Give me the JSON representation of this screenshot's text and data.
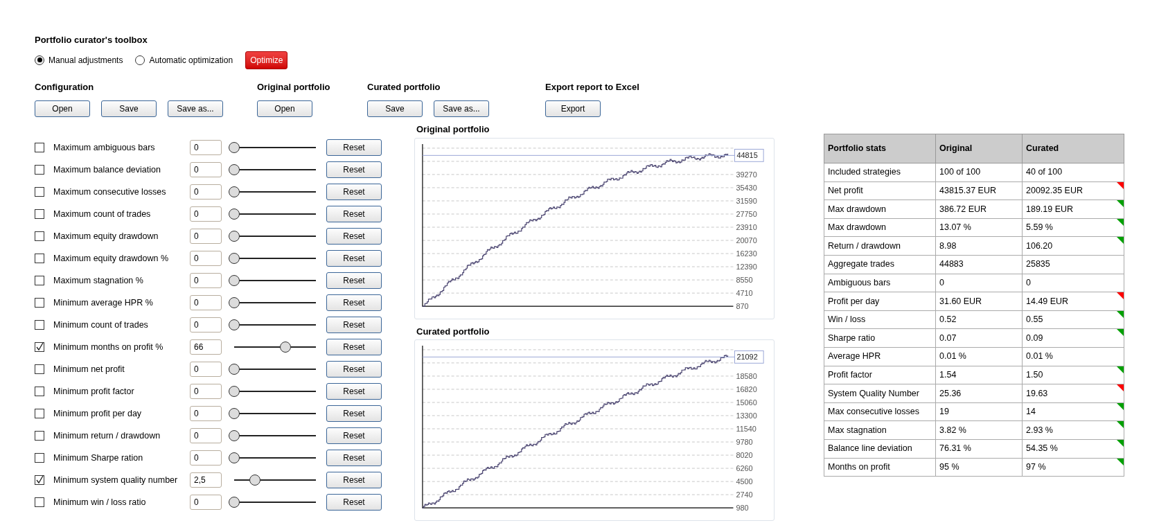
{
  "title": "Portfolio curator's toolbox",
  "modes": [
    {
      "label": "Manual adjustments",
      "selected": true
    },
    {
      "label": "Automatic optimization",
      "selected": false
    }
  ],
  "optimize_button": "Optimize",
  "file_groups": [
    {
      "heading": "Configuration",
      "buttons": [
        "Open",
        "Save",
        "Save as..."
      ]
    },
    {
      "heading": "Original portfolio",
      "buttons": [
        "Open"
      ]
    },
    {
      "heading": "Curated portfolio",
      "buttons": [
        "Save",
        "Save as..."
      ]
    },
    {
      "heading": "Export report to Excel",
      "buttons": [
        "Export"
      ]
    }
  ],
  "filters": [
    {
      "label": "Maximum ambiguous bars",
      "checked": false,
      "value": "0",
      "level": 0,
      "reset": "Reset"
    },
    {
      "label": "Maximum balance deviation",
      "checked": false,
      "value": "0",
      "level": 0,
      "reset": "Reset"
    },
    {
      "label": "Maximum consecutive losses",
      "checked": false,
      "value": "0",
      "level": 0,
      "reset": "Reset"
    },
    {
      "label": "Maximum count of trades",
      "checked": false,
      "value": "0",
      "level": 0,
      "reset": "Reset"
    },
    {
      "label": "Maximum equity drawdown",
      "checked": false,
      "value": "0",
      "level": 0,
      "reset": "Reset"
    },
    {
      "label": "Maximum equity drawdown %",
      "checked": false,
      "value": "0",
      "level": 0,
      "reset": "Reset"
    },
    {
      "label": "Maximum stagnation %",
      "checked": false,
      "value": "0",
      "level": 0,
      "reset": "Reset"
    },
    {
      "label": "Minimum average HPR %",
      "checked": false,
      "value": "0",
      "level": 0,
      "reset": "Reset"
    },
    {
      "label": "Minimum count of trades",
      "checked": false,
      "value": "0",
      "level": 0,
      "reset": "Reset"
    },
    {
      "label": "Minimum months on profit %",
      "checked": true,
      "value": "66",
      "level": 0.63,
      "reset": "Reset"
    },
    {
      "label": "Minimum net profit",
      "checked": false,
      "value": "0",
      "level": 0,
      "reset": "Reset"
    },
    {
      "label": "Minimum profit factor",
      "checked": false,
      "value": "0",
      "level": 0,
      "reset": "Reset"
    },
    {
      "label": "Minimum profit per day",
      "checked": false,
      "value": "0",
      "level": 0,
      "reset": "Reset"
    },
    {
      "label": "Minimum return / drawdown",
      "checked": false,
      "value": "0",
      "level": 0,
      "reset": "Reset"
    },
    {
      "label": "Minimum Sharpe ration",
      "checked": false,
      "value": "0",
      "level": 0,
      "reset": "Reset"
    },
    {
      "label": "Minimum system quality number",
      "checked": true,
      "value": "2,5",
      "level": 0.25,
      "reset": "Reset"
    },
    {
      "label": "Minimum win / loss ratio",
      "checked": false,
      "value": "0",
      "level": 0,
      "reset": "Reset"
    }
  ],
  "charts": [
    {
      "title": "Original portfolio",
      "current_value": "44815",
      "y_labels": [
        "39270",
        "35430",
        "31590",
        "27750",
        "23910",
        "20070",
        "16230",
        "12390",
        "8550",
        "4710",
        "870"
      ]
    },
    {
      "title": "Curated portfolio",
      "current_value": "21092",
      "y_labels": [
        "18580",
        "16820",
        "15060",
        "13300",
        "11540",
        "9780",
        "8020",
        "6260",
        "4500",
        "2740",
        "980"
      ]
    }
  ],
  "stats": {
    "columns": [
      "Portfolio stats",
      "Original",
      "Curated"
    ],
    "rows": [
      {
        "name": "Included strategies",
        "original": "100 of 100",
        "curated": "40 of 100"
      },
      {
        "name": "Net profit",
        "original": "43815.37 EUR",
        "curated": "20092.35 EUR",
        "color": "#ff0000"
      },
      {
        "name": "Max drawdown",
        "original": "386.72 EUR",
        "curated": "189.19 EUR",
        "color": "#00a000"
      },
      {
        "name": "Max drawdown",
        "original": "13.07 %",
        "curated": "5.59 %",
        "color": "#00a000"
      },
      {
        "name": "Return / drawdown",
        "original": "8.98",
        "curated": "106.20",
        "color": "#00a000"
      },
      {
        "name": "Aggregate trades",
        "original": "44883",
        "curated": "25835"
      },
      {
        "name": "Ambiguous bars",
        "original": "0",
        "curated": "0"
      },
      {
        "name": "Profit per day",
        "original": "31.60 EUR",
        "curated": "14.49 EUR",
        "color": "#ff0000"
      },
      {
        "name": "Win / loss",
        "original": "0.52",
        "curated": "0.55",
        "color": "#00a000"
      },
      {
        "name": "Sharpe ratio",
        "original": "0.07",
        "curated": "0.09",
        "color": "#00a000"
      },
      {
        "name": "Average HPR",
        "original": "0.01 %",
        "curated": "0.01 %"
      },
      {
        "name": "Profit factor",
        "original": "1.54",
        "curated": "1.50",
        "color": "#00a000"
      },
      {
        "name": "System Quality Number",
        "original": "25.36",
        "curated": "19.63",
        "color": "#ff0000"
      },
      {
        "name": "Max consecutive losses",
        "original": "19",
        "curated": "14",
        "color": "#00a000"
      },
      {
        "name": "Max stagnation",
        "original": "3.82 %",
        "curated": "2.93 %",
        "color": "#00a000"
      },
      {
        "name": "Balance line deviation",
        "original": "76.31 %",
        "curated": "54.35 %",
        "color": "#00a000"
      },
      {
        "name": "Months on profit",
        "original": "95 %",
        "curated": "97 %",
        "color": "#00a000"
      }
    ]
  }
}
